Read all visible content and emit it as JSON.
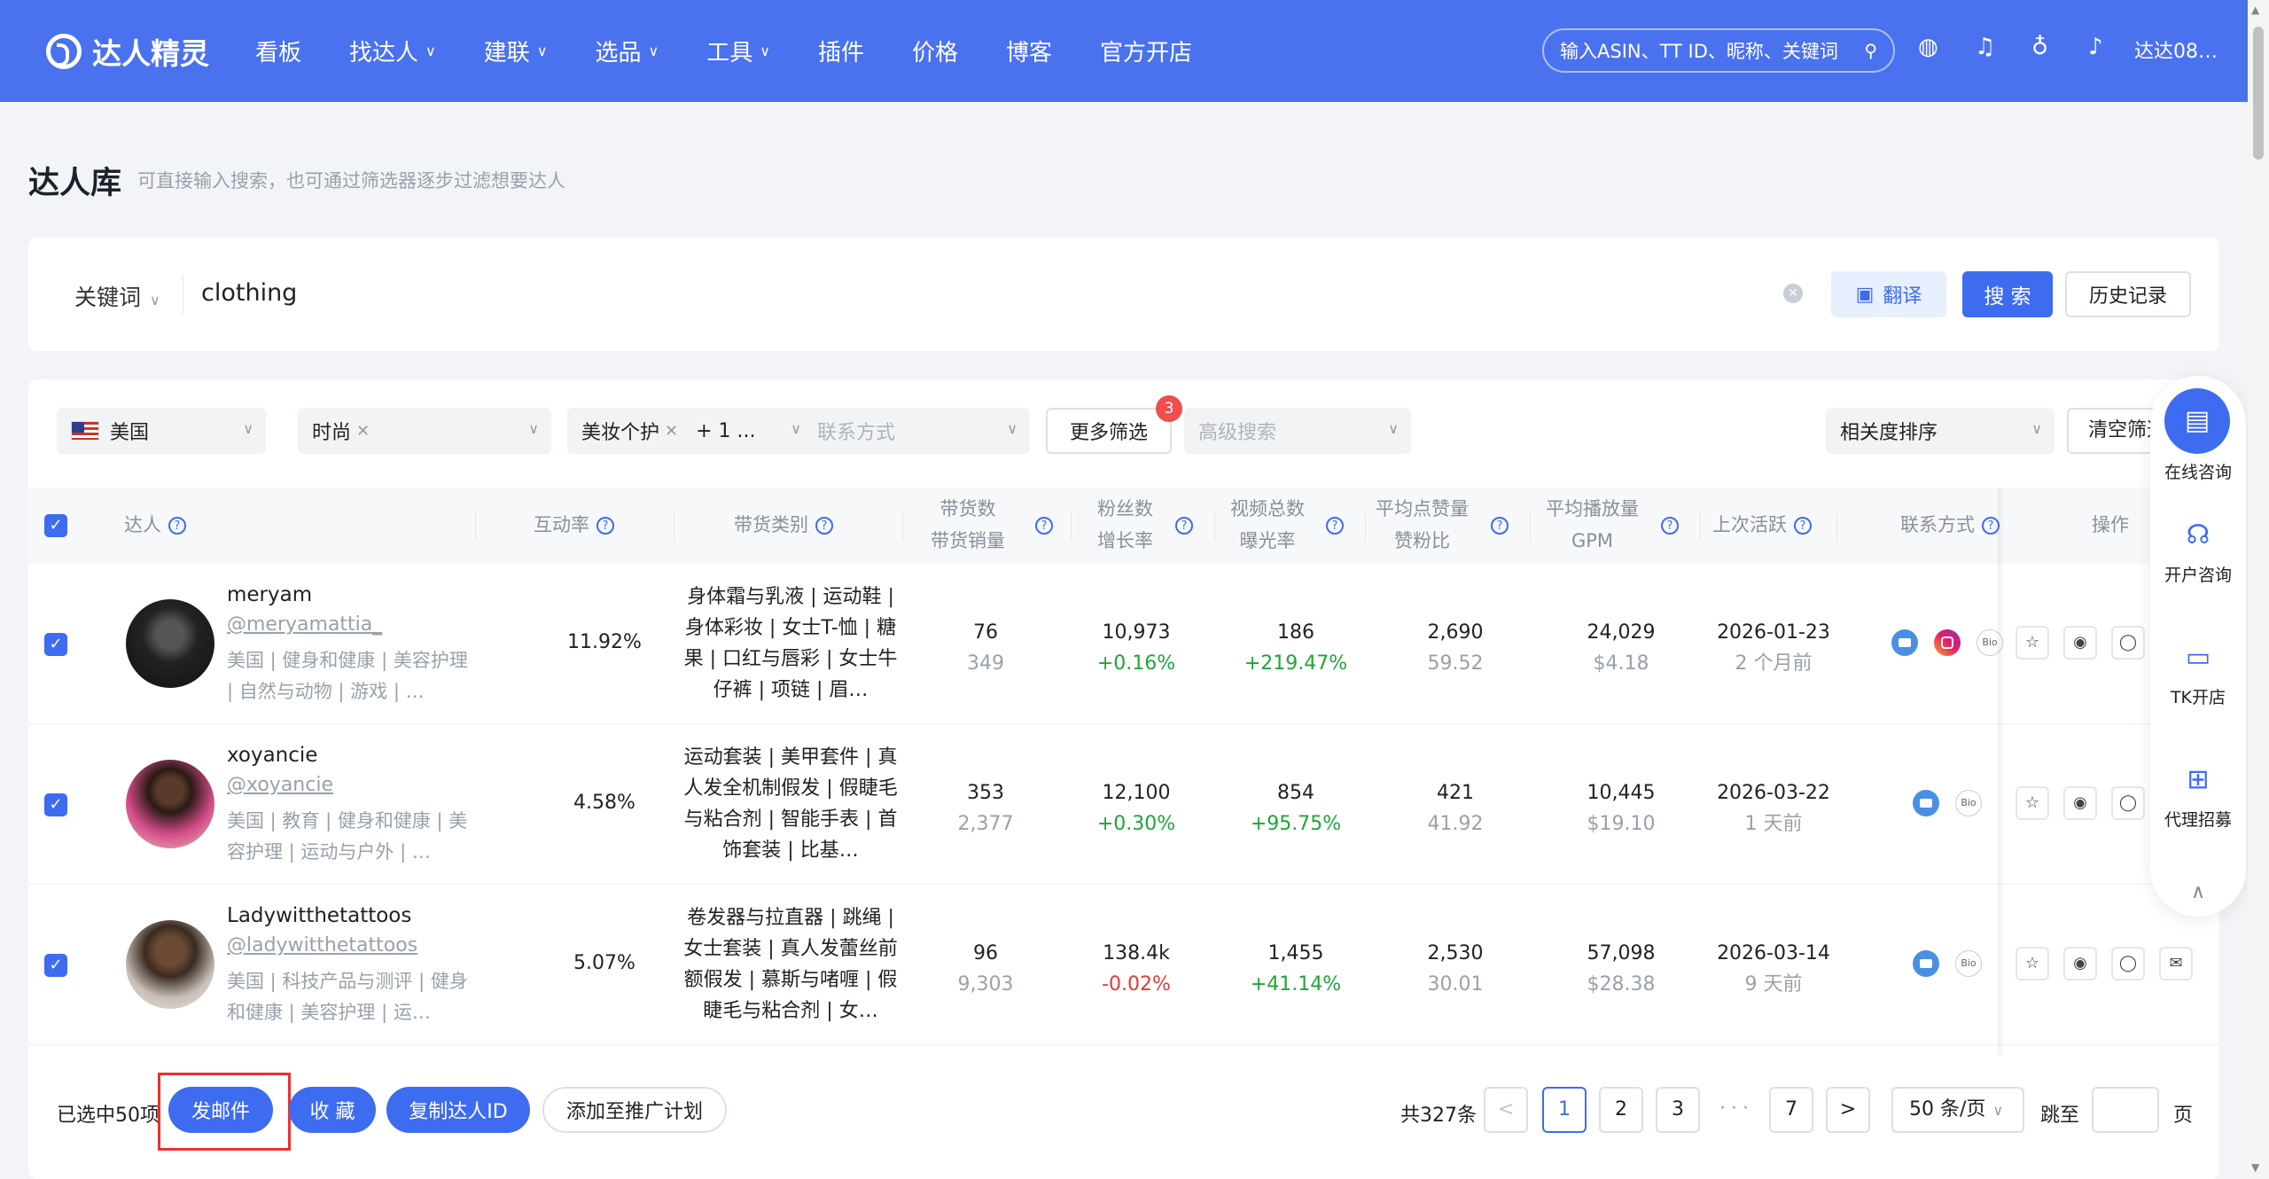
{
  "header": {
    "brand": "达人精灵",
    "nav": [
      {
        "label": "看板",
        "has_dropdown": false
      },
      {
        "label": "找达人",
        "has_dropdown": true
      },
      {
        "label": "建联",
        "has_dropdown": true
      },
      {
        "label": "选品",
        "has_dropdown": true
      },
      {
        "label": "工具",
        "has_dropdown": true
      },
      {
        "label": "插件",
        "has_dropdown": false
      },
      {
        "label": "价格",
        "has_dropdown": false
      },
      {
        "label": "博客",
        "has_dropdown": false
      },
      {
        "label": "官方开店",
        "has_dropdown": false
      }
    ],
    "search_placeholder": "输入ASIN、TT ID、昵称、关键词",
    "user": "达达08…",
    "icons": [
      "globe-icon",
      "headset-icon",
      "bulb-icon",
      "bell-icon"
    ]
  },
  "page": {
    "title": "达人库",
    "subtitle": "可直接输入搜索，也可通过筛选器逐步过滤想要达人"
  },
  "search": {
    "field_label": "关键词",
    "value": "clothing",
    "translate_label": "翻译",
    "search_label": "搜 索",
    "history_label": "历史记录"
  },
  "filters": {
    "country": "美国",
    "category": "时尚",
    "subcategory": "美妆个护",
    "subcategory_more": "+ 1 ...",
    "contact_placeholder": "联系方式",
    "more_label": "更多筛选",
    "more_badge": "3",
    "advanced_placeholder": "高级搜索",
    "sort": "相关度排序",
    "clear_label": "清空筛选"
  },
  "table": {
    "headers": {
      "kol": "达人",
      "engagement": "互动率",
      "category": "带货类别",
      "goods_a": "带货数",
      "goods_b": "带货销量",
      "fans_a": "粉丝数",
      "fans_b": "增长率",
      "videos_a": "视频总数",
      "videos_b": "曝光率",
      "likes_a": "平均点赞量",
      "likes_b": "赞粉比",
      "plays_a": "平均播放量",
      "plays_b": "GPM",
      "active": "上次活跃",
      "contact": "联系方式",
      "ops": "操作"
    },
    "rows": [
      {
        "name": "meryam",
        "handle": "@meryamattia_",
        "tags": "美国 | 健身和健康 | 美容护理 | 自然与动物 | 游戏 | …",
        "engagement": "11.92%",
        "categories": "身体霜与乳液 | 运动鞋 | 身体彩妆 | 女士T-恤 | 糖果 | 口红与唇彩 | 女士牛仔裤 | 项链 | 眉…",
        "goods": "76",
        "sales": "349",
        "fans": "10,973",
        "fans_growth": "+0.16%",
        "videos": "186",
        "exposure": "+219.47%",
        "avg_likes": "2,690",
        "like_ratio": "59.52",
        "avg_plays": "24,029",
        "gpm": "$4.18",
        "last_active": "2026-01-23",
        "last_active_rel": "2 个月前",
        "contacts": [
          "email",
          "instagram",
          "bio"
        ]
      },
      {
        "name": "xoyancie",
        "handle": "@xoyancie",
        "tags": "美国 | 教育 | 健身和健康 | 美容护理 | 运动与户外 | …",
        "engagement": "4.58%",
        "categories": "运动套装 | 美甲套件 | 真人发全机制假发 | 假睫毛与粘合剂 | 智能手表 | 首饰套装 | 比基…",
        "goods": "353",
        "sales": "2,377",
        "fans": "12,100",
        "fans_growth": "+0.30%",
        "videos": "854",
        "exposure": "+95.75%",
        "avg_likes": "421",
        "like_ratio": "41.92",
        "avg_plays": "10,445",
        "gpm": "$19.10",
        "last_active": "2026-03-22",
        "last_active_rel": "1 天前",
        "contacts": [
          "email",
          "bio"
        ]
      },
      {
        "name": "Ladywitthetattoos",
        "handle": "@ladywitthetattoos",
        "tags": "美国 | 科技产品与测评 | 健身和健康 | 美容护理 | 运…",
        "engagement": "5.07%",
        "categories": "卷发器与拉直器 | 跳绳 | 女士套装 | 真人发蕾丝前额假发 | 慕斯与啫喱 | 假睫毛与粘合剂 | 女…",
        "goods": "96",
        "sales": "9,303",
        "fans": "138.4k",
        "fans_growth": "-0.02%",
        "videos": "1,455",
        "exposure": "+41.14%",
        "avg_likes": "2,530",
        "like_ratio": "30.01",
        "avg_plays": "57,098",
        "gpm": "$28.38",
        "last_active": "2026-03-14",
        "last_active_rel": "9 天前",
        "contacts": [
          "email",
          "bio"
        ]
      }
    ]
  },
  "footer": {
    "selected": "已选中50项",
    "btn_email": "发邮件",
    "btn_fav": "收 藏",
    "btn_copy": "复制达人ID",
    "btn_add": "添加至推广计划",
    "total": "共327条",
    "pages": [
      "1",
      "2",
      "3",
      "7"
    ],
    "current_page": "1",
    "page_size": "50 条/页",
    "jump_label": "跳至",
    "page_unit": "页"
  },
  "float_panel": {
    "items": [
      {
        "label": "在线咨询",
        "icon": "chat-icon"
      },
      {
        "label": "开户咨询",
        "icon": "headset-icon"
      },
      {
        "label": "TK开店",
        "icon": "shop-bag-icon"
      },
      {
        "label": "代理招募",
        "icon": "bookmark-plus-icon"
      }
    ]
  },
  "colors": {
    "brand": "#4a72ee",
    "primary": "#3d6cf0",
    "positive": "#22a33a",
    "negative": "#e03b3b",
    "highlight_box": "#e8312f"
  }
}
